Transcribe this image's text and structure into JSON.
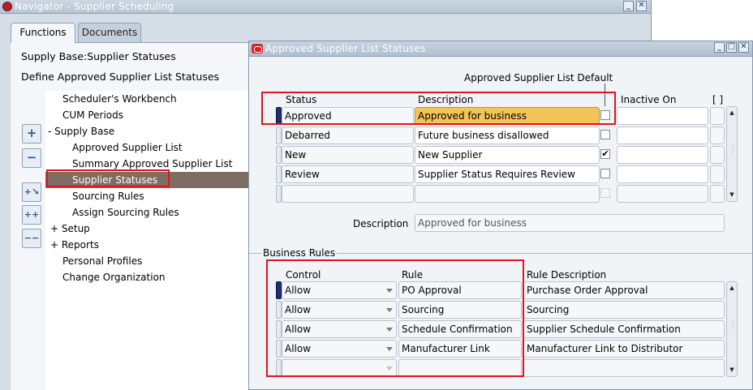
{
  "navigator": {
    "title": "Navigator - Supplier Scheduling",
    "tabs": [
      "Functions",
      "Documents"
    ],
    "heading1": "Supply Base:Supplier Statuses",
    "heading2": "Define Approved Supplier List Statuses",
    "tree": [
      {
        "label": "Scheduler's Workbench"
      },
      {
        "label": "CUM Periods"
      },
      {
        "label": "-  Supply Base"
      },
      {
        "label": "Approved Supplier List"
      },
      {
        "label": "Summary Approved Supplier List"
      },
      {
        "label": "Supplier Statuses"
      },
      {
        "label": "Sourcing Rules"
      },
      {
        "label": "Assign Sourcing Rules"
      },
      {
        "label": "+  Setup"
      },
      {
        "label": "+  Reports"
      },
      {
        "label": "Personal Profiles"
      },
      {
        "label": "Change Organization"
      }
    ],
    "side_buttons": [
      "plus-icon",
      "minus-icon",
      "expand-branch-icon",
      "expand-all-icon",
      "collapse-all-icon"
    ]
  },
  "asl": {
    "title": "Approved Supplier List Statuses",
    "asl_default_label": "Approved Supplier List Default",
    "headers": {
      "status": "Status",
      "description": "Description",
      "inactive_on": "Inactive On",
      "flex": "[ ]"
    },
    "rows": [
      {
        "status": "Approved",
        "description": "Approved for business",
        "default": ""
      },
      {
        "status": "Debarred",
        "description": "Future business disallowed",
        "default": ""
      },
      {
        "status": "New",
        "description": "New Supplier",
        "default": "✔"
      },
      {
        "status": "Review",
        "description": "Supplier Status Requires Review",
        "default": ""
      },
      {
        "status": "",
        "description": "",
        "default": ""
      }
    ],
    "description_label": "Description",
    "description_value": "Approved for business",
    "business_rules_label": "Business Rules",
    "rule_headers": {
      "control": "Control",
      "rule": "Rule",
      "rule_description": "Rule Description"
    },
    "rules": [
      {
        "control": "Allow",
        "rule": "PO Approval",
        "description": "Purchase Order Approval"
      },
      {
        "control": "Allow",
        "rule": "Sourcing",
        "description": "Sourcing"
      },
      {
        "control": "Allow",
        "rule": "Schedule Confirmation",
        "description": "Supplier Schedule Confirmation"
      },
      {
        "control": "Allow",
        "rule": "Manufacturer Link",
        "description": "Manufacturer Link to Distributor"
      },
      {
        "control": "",
        "rule": "",
        "description": ""
      }
    ]
  },
  "colors": {
    "active_field": "#f2c45a",
    "highlight_box": "#e0141b",
    "tree_selection": "#7d6d62"
  }
}
